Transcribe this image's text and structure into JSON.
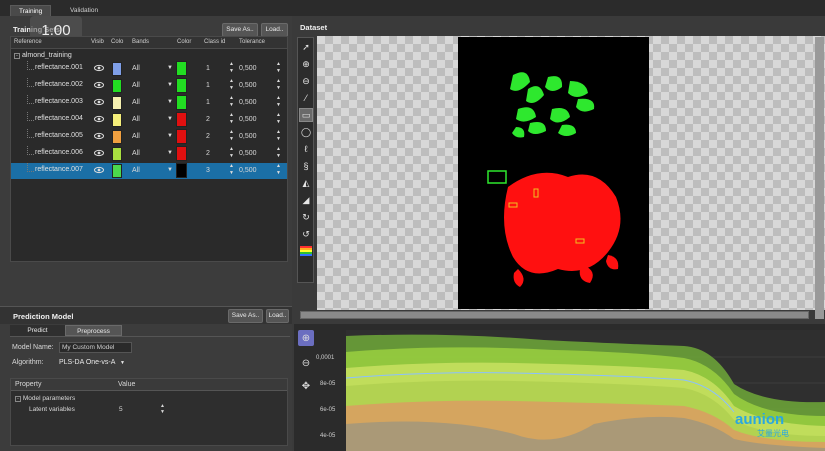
{
  "tabs": [
    "Training",
    "Validation"
  ],
  "overlay_zoom": "1.00",
  "training_sets": {
    "title": "Training Sets",
    "save_as": "Save As..",
    "load": "Load..",
    "columns": [
      "Reference",
      "Visib",
      "Colo",
      "Bands",
      "Color",
      "Class id",
      "Tolerance"
    ],
    "root": "almond_training",
    "rows": [
      {
        "name": "reflectance.001",
        "swatch": "#7f9fe8",
        "bands": "All",
        "color": "#22dd22",
        "class_id": "1",
        "tolerance": "0,500"
      },
      {
        "name": "reflectance.002",
        "swatch": "#22dd22",
        "bands": "All",
        "color": "#22dd22",
        "class_id": "1",
        "tolerance": "0,500"
      },
      {
        "name": "reflectance.003",
        "swatch": "#f5f0b0",
        "bands": "All",
        "color": "#22dd22",
        "class_id": "1",
        "tolerance": "0,500"
      },
      {
        "name": "reflectance.004",
        "swatch": "#f5ef7a",
        "bands": "All",
        "color": "#e01010",
        "class_id": "2",
        "tolerance": "0,500"
      },
      {
        "name": "reflectance.005",
        "swatch": "#f0a040",
        "bands": "All",
        "color": "#e01010",
        "class_id": "2",
        "tolerance": "0,500"
      },
      {
        "name": "reflectance.006",
        "swatch": "#a8e040",
        "bands": "All",
        "color": "#e01010",
        "class_id": "2",
        "tolerance": "0,500"
      },
      {
        "name": "reflectance.007",
        "swatch": "#4cd84c",
        "bands": "All",
        "color": "#000000",
        "class_id": "3",
        "tolerance": "0,500"
      }
    ]
  },
  "prediction_model": {
    "title": "Prediction Model",
    "save_as": "Save As..",
    "load": "Load..",
    "tabs": [
      "Predict",
      "Preprocess"
    ],
    "model_name_label": "Model Name:",
    "model_name_value": "My Custom Model",
    "algorithm_label": "Algorithm:",
    "algorithm_value": "PLS-DA One-vs-A",
    "property_header": "Property",
    "value_header": "Value",
    "group": "Model parameters",
    "param_label": "Latent variables",
    "param_value": "5"
  },
  "dataset": {
    "title": "Dataset"
  },
  "spectra": {
    "y_ticks": [
      "0,0001",
      "8e-05",
      "6e-05",
      "4e-05"
    ]
  },
  "watermark": {
    "brand": "aunion",
    "sub": "艾量光电"
  }
}
